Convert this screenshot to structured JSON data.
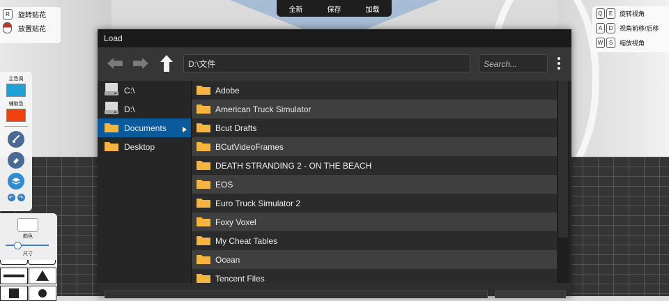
{
  "toolbar": {
    "new_label": "全新",
    "save_label": "保存",
    "load_label": "加载"
  },
  "hints_left": [
    {
      "key": "R",
      "label": "旋转贴花"
    },
    {
      "key": "",
      "label": "放置贴花"
    }
  ],
  "hints_right": [
    {
      "keys": [
        "Q",
        "E"
      ],
      "label": "旋转视角"
    },
    {
      "keys": [
        "A",
        "D"
      ],
      "label": "视角前移/后移"
    },
    {
      "keys": [
        "W",
        "S"
      ],
      "label": "缩放视角"
    }
  ],
  "tool_panel": {
    "primary_label": "主色调",
    "primary_color": "#1ea2d8",
    "secondary_label": "辅助色",
    "secondary_color": "#f0410f"
  },
  "brush_panel": {
    "color_label": "颜色",
    "size_label": "尺寸",
    "size_value": 0.25
  },
  "dialog": {
    "title": "Load",
    "path": "D:\\文件",
    "search_placeholder": "Search...",
    "sidebar": [
      {
        "label": "C:\\",
        "type": "drive"
      },
      {
        "label": "D:\\",
        "type": "drive"
      },
      {
        "label": "Documents",
        "type": "folder",
        "active": true
      },
      {
        "label": "Desktop",
        "type": "folder"
      }
    ],
    "files": [
      "Adobe",
      "American Truck Simulator",
      "Bcut Drafts",
      "BCutVideoFrames",
      "DEATH STRANDING 2 - ON THE BEACH",
      "EOS",
      "Euro Truck Simulator 2",
      "Foxy Voxel",
      "My Cheat Tables",
      "Ocean",
      "Tencent Files"
    ],
    "folder_color": "#f7b541"
  }
}
